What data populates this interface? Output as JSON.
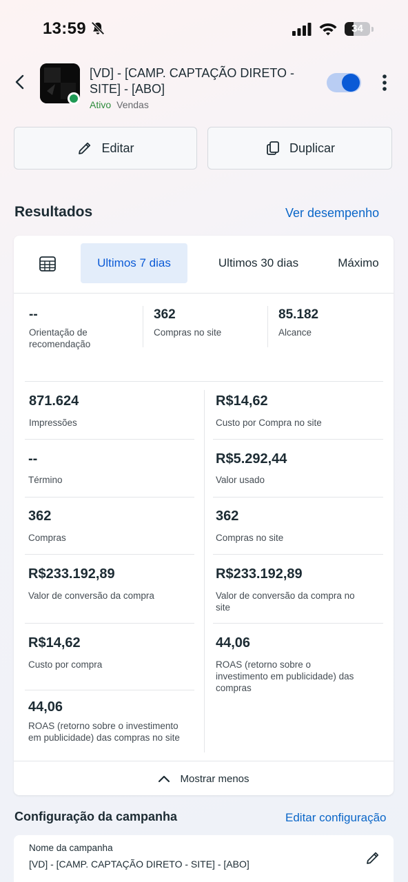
{
  "status_bar": {
    "time": "13:59",
    "battery": "34",
    "battery_level": 0.34
  },
  "header": {
    "title": "[VD] - [CAMP. CAPTAÇÃO DIRETO - SITE] - [ABO]",
    "status": "Ativo",
    "objective": "Vendas",
    "toggle_on": true
  },
  "actions": {
    "edit_label": "Editar",
    "duplicate_label": "Duplicar"
  },
  "results": {
    "title": "Resultados",
    "link": "Ver desempenho",
    "tabs": [
      "Ultimos 7 dias",
      "Ultimos 30 dias",
      "Máximo"
    ],
    "selected_tab": "Ultimos 7 dias",
    "top_metrics": [
      {
        "value": "--",
        "label": "Orientação de recomendação"
      },
      {
        "value": "362",
        "label": "Compras no site"
      },
      {
        "value": "85.182",
        "label": "Alcance"
      }
    ],
    "left_metrics": [
      {
        "value": "871.624",
        "label": "Impressões"
      },
      {
        "value": "--",
        "label": "Término"
      },
      {
        "value": "362",
        "label": "Compras"
      },
      {
        "value": "R$233.192,89",
        "label": "Valor de conversão da compra"
      },
      {
        "value": "R$14,62",
        "label": "Custo por compra"
      },
      {
        "value": "44,06",
        "label": "ROAS (retorno sobre o investimento em publicidade) das compras no site"
      }
    ],
    "right_metrics": [
      {
        "value": "R$14,62",
        "label": "Custo por Compra no site"
      },
      {
        "value": "R$5.292,44",
        "label": "Valor usado"
      },
      {
        "value": "362",
        "label": "Compras no site"
      },
      {
        "value": "R$233.192,89",
        "label": "Valor de conversão da compra no site"
      },
      {
        "value": "44,06",
        "label": "ROAS (retorno sobre o investimento em publicidade) das compras"
      }
    ],
    "show_less": "Mostrar menos"
  },
  "config": {
    "title": "Configuração da campanha",
    "link": "Editar configuração",
    "name_label": "Nome da campanha",
    "name_value": "[VD] - [CAMP. CAPTAÇÃO DIRETO - SITE] - [ABO]"
  },
  "colors": {
    "accent": "#0a5ad6",
    "link": "#0a66c8",
    "active": "#2e8b3b"
  }
}
